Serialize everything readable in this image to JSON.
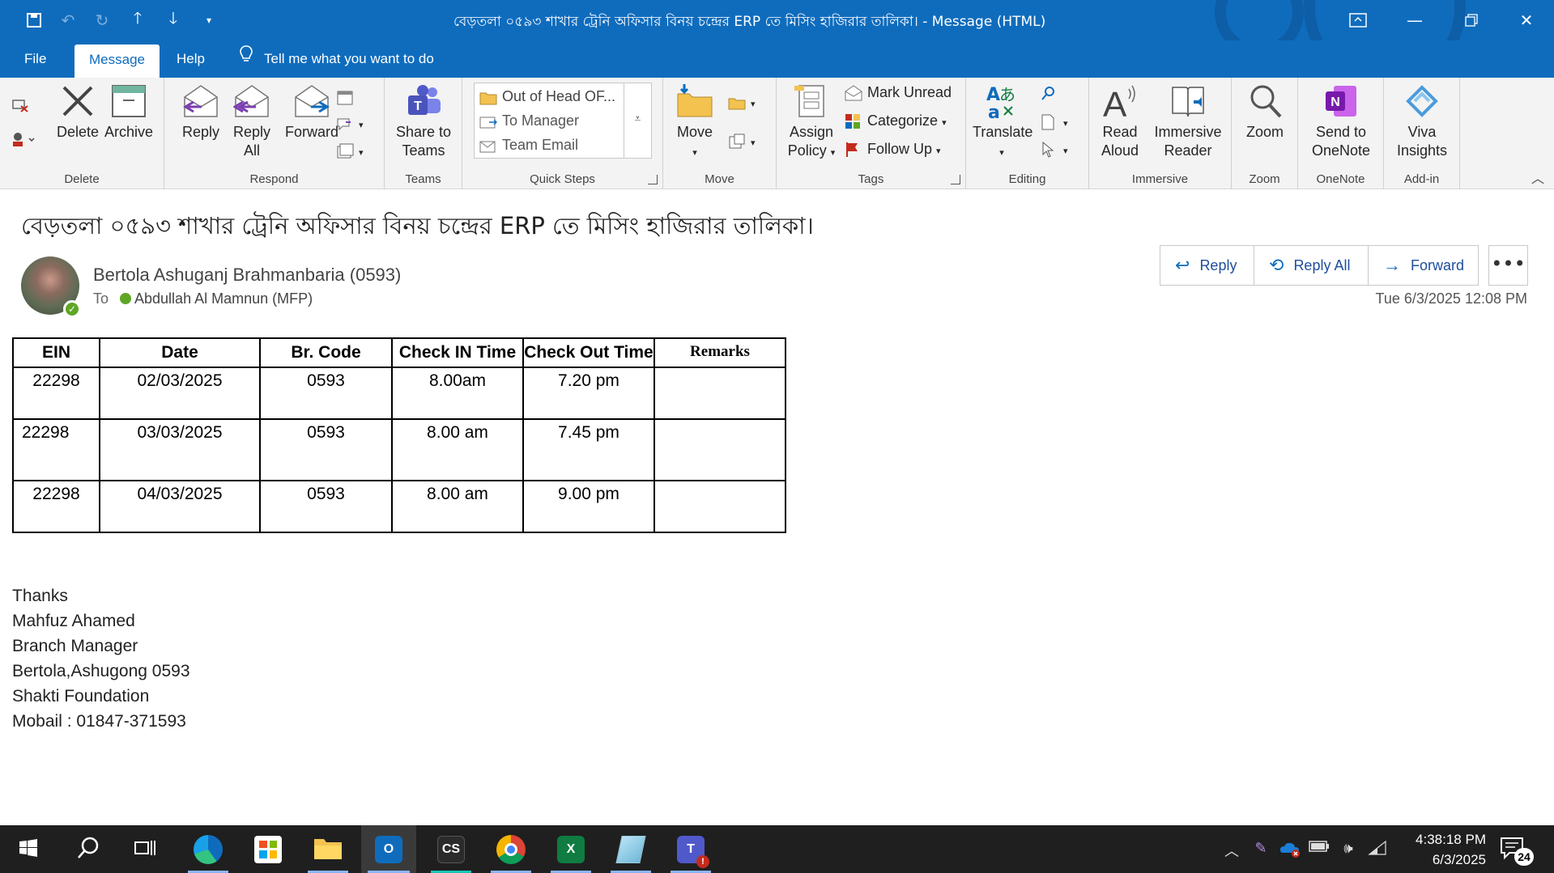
{
  "window": {
    "title": "বেড়তলা ০৫৯৩ শাখার ট্রেনি অফিসার বিনয় চন্দ্রের ERP তে মিসিং হাজিরার তালিকা।  -  Message (HTML)",
    "brand_color": "#0f6cbd"
  },
  "menu": {
    "tabs": [
      "File",
      "Message",
      "Help"
    ],
    "active_tab": "Message",
    "tell_me": "Tell me what you want to do"
  },
  "ribbon": {
    "delete_group": {
      "label": "Delete",
      "delete": "Delete",
      "archive": "Archive"
    },
    "respond_group": {
      "label": "Respond",
      "reply": "Reply",
      "reply_all_1": "Reply",
      "reply_all_2": "All",
      "forward": "Forward"
    },
    "teams_group": {
      "label": "Teams",
      "share_1": "Share to",
      "share_2": "Teams"
    },
    "quick_steps": {
      "label": "Quick Steps",
      "items": [
        "Out of Head OF...",
        "To Manager",
        "Team Email"
      ]
    },
    "move_group": {
      "label": "Move",
      "move": "Move"
    },
    "tags_group": {
      "label": "Tags",
      "assign_1": "Assign",
      "assign_2": "Policy",
      "mark_unread": "Mark Unread",
      "categorize": "Categorize",
      "follow_up": "Follow Up"
    },
    "editing_group": {
      "label": "Editing",
      "translate": "Translate"
    },
    "immersive_group": {
      "label": "Immersive",
      "read_1": "Read",
      "read_2": "Aloud",
      "reader_1": "Immersive",
      "reader_2": "Reader"
    },
    "zoom_group": {
      "label": "Zoom",
      "zoom": "Zoom"
    },
    "onenote_group": {
      "label": "OneNote",
      "send_1": "Send to",
      "send_2": "OneNote"
    },
    "addin_group": {
      "label": "Add-in",
      "viva_1": "Viva",
      "viva_2": "Insights"
    }
  },
  "message": {
    "subject": "বেড়তলা ০৫৯৩ শাখার ট্রেনি অফিসার বিনয় চন্দ্রের ERP তে মিসিং হাজিরার তালিকা।",
    "sender": "Bertola Ashuganj Brahmanbaria (0593)",
    "to_label": "To",
    "recipient": "Abdullah Al Mamnun (MFP)",
    "date": "Tue 6/3/2025 12:08 PM",
    "actions": {
      "reply": "Reply",
      "reply_all": "Reply All",
      "forward": "Forward",
      "more": "•••"
    },
    "table": {
      "headers": [
        "EIN",
        "Date",
        "Br. Code",
        "Check IN Time",
        "Check Out Time",
        "Remarks"
      ],
      "rows": [
        [
          "22298",
          "02/03/2025",
          "0593",
          "8.00am",
          "7.20 pm",
          ""
        ],
        [
          "22298",
          "03/03/2025",
          "0593",
          "8.00 am",
          "7.45 pm",
          ""
        ],
        [
          "22298",
          "04/03/2025",
          "0593",
          "8.00 am",
          "9.00 pm",
          ""
        ]
      ]
    },
    "signature": [
      "Thanks",
      "Mahfuz Ahamed",
      "Branch Manager",
      "Bertola,Ashugong 0593",
      "Shakti Foundation",
      "Mobail : 01847-371593"
    ]
  },
  "taskbar": {
    "apps": [
      "start",
      "search",
      "task-view",
      "edge",
      "store",
      "file-explorer",
      "outlook",
      "cs",
      "chrome",
      "excel",
      "notepad",
      "teams"
    ],
    "cs_label": "CS",
    "time": "4:38:18 PM",
    "date": "6/3/2025",
    "notification_count": "24"
  }
}
